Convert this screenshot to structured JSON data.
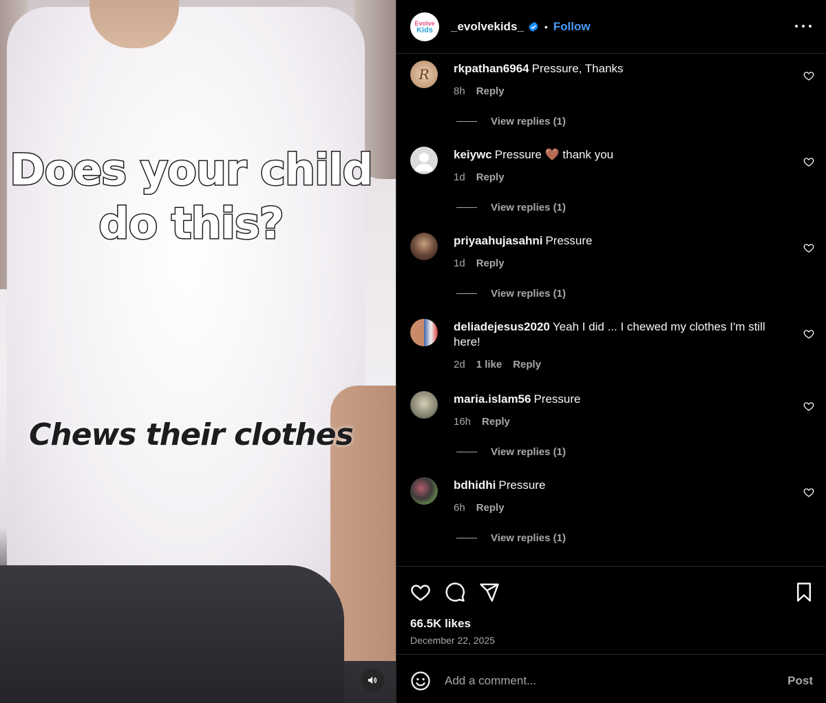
{
  "media": {
    "overlay_text_1": "Does your child do this?",
    "overlay_text_2": "Chews their clothes",
    "mute_icon": "speaker-icon"
  },
  "header": {
    "logo_text_1": "Evolve",
    "logo_text_2": "Kids",
    "username": "_evolvekids_",
    "verified_icon": "verified-badge-icon",
    "separator": "•",
    "follow_label": "Follow",
    "more_icon": "more-options-icon"
  },
  "comments": [
    {
      "user": "rkpathan6964",
      "text": "Pressure, Thanks",
      "time": "8h",
      "likes": "",
      "reply_label": "Reply",
      "view_replies": "View replies (1)",
      "avatar_color": "#c9a58a"
    },
    {
      "user": "keiywc",
      "text": "Pressure 🤎 thank you",
      "time": "1d",
      "likes": "",
      "reply_label": "Reply",
      "view_replies": "View replies (1)",
      "avatar_color": "#dbdbdb"
    },
    {
      "user": "priyaahujasahni",
      "text": "Pressure",
      "time": "1d",
      "likes": "",
      "reply_label": "Reply",
      "view_replies": "View replies (1)",
      "avatar_color": "#6b4a3a"
    },
    {
      "user": "deliadejesus2020",
      "text": "Yeah I did ... I chewed my clothes I'm still here!",
      "time": "2d",
      "likes": "1 like",
      "reply_label": "Reply",
      "view_replies": "",
      "avatar_color": "#4f6fb0"
    },
    {
      "user": "maria.islam56",
      "text": "Pressure",
      "time": "16h",
      "likes": "",
      "reply_label": "Reply",
      "view_replies": "View replies (1)",
      "avatar_color": "#8c8a78"
    },
    {
      "user": "bdhidhi",
      "text": "Pressure",
      "time": "6h",
      "likes": "",
      "reply_label": "Reply",
      "view_replies": "View replies (1)",
      "avatar_color": "#3e3a3a"
    }
  ],
  "actions": {
    "like_icon": "heart-icon",
    "comment_icon": "comment-icon",
    "share_icon": "share-icon",
    "save_icon": "bookmark-icon",
    "likes_count": "66.5K likes",
    "date": "December 22, 2025"
  },
  "add_comment": {
    "emoji_icon": "emoji-icon",
    "placeholder": "Add a comment...",
    "post_label": "Post"
  },
  "colors": {
    "background": "#000000",
    "accent_blue": "#4a9df8",
    "text_secondary": "#a8a8a8",
    "divider": "#262626"
  }
}
